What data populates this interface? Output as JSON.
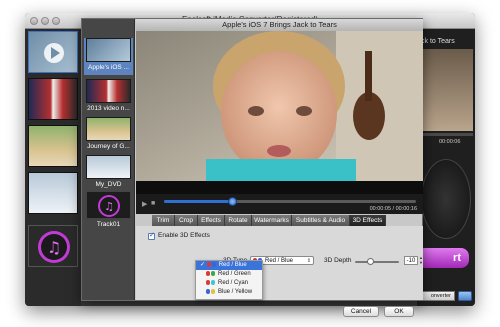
{
  "app": {
    "title": "Enolsoft iMedia Converter(Registered)",
    "right_title_partial": "ck to Tears",
    "right_time_partial": "00:00:06",
    "convert_partial": "rt",
    "format_partial": "onverter"
  },
  "file_list": {
    "items": [
      {
        "label": "Apple's iOS ...",
        "selected": true
      },
      {
        "label": "2013 video n...",
        "selected": false
      },
      {
        "label": "Journey of G...",
        "selected": false
      },
      {
        "label": "My_DVD",
        "selected": false
      },
      {
        "label": "Track01",
        "selected": false
      }
    ]
  },
  "preview": {
    "title": "Apple's iOS 7 Brings Jack to Tears",
    "timecode": "00:00:05 / 00:00:16",
    "progress": 0.27
  },
  "tabs": [
    {
      "label": "Trim",
      "active": false
    },
    {
      "label": "Crop",
      "active": false
    },
    {
      "label": "Effects",
      "active": false
    },
    {
      "label": "Rotate",
      "active": false
    },
    {
      "label": "Watermarks",
      "active": false
    },
    {
      "label": "Subtitles & Audio",
      "active": false
    },
    {
      "label": "3D Effects",
      "active": true
    }
  ],
  "effects3d": {
    "enable_label": "Enable 3D Effects",
    "enabled": true,
    "type_label": "3D Type",
    "type_value": "Red / Blue",
    "depth_label": "3D Depth",
    "depth_value": "-10",
    "depth_fraction": 0.35,
    "type_options": [
      "Red / Blue",
      "Red / Green",
      "Red / Cyan",
      "Blue / Yellow"
    ]
  },
  "buttons": {
    "cancel": "Cancel",
    "ok": "OK"
  },
  "colors": {
    "selection": "#3a73d9",
    "progress": "#2f6fd0",
    "convert": "#c23bd6"
  }
}
